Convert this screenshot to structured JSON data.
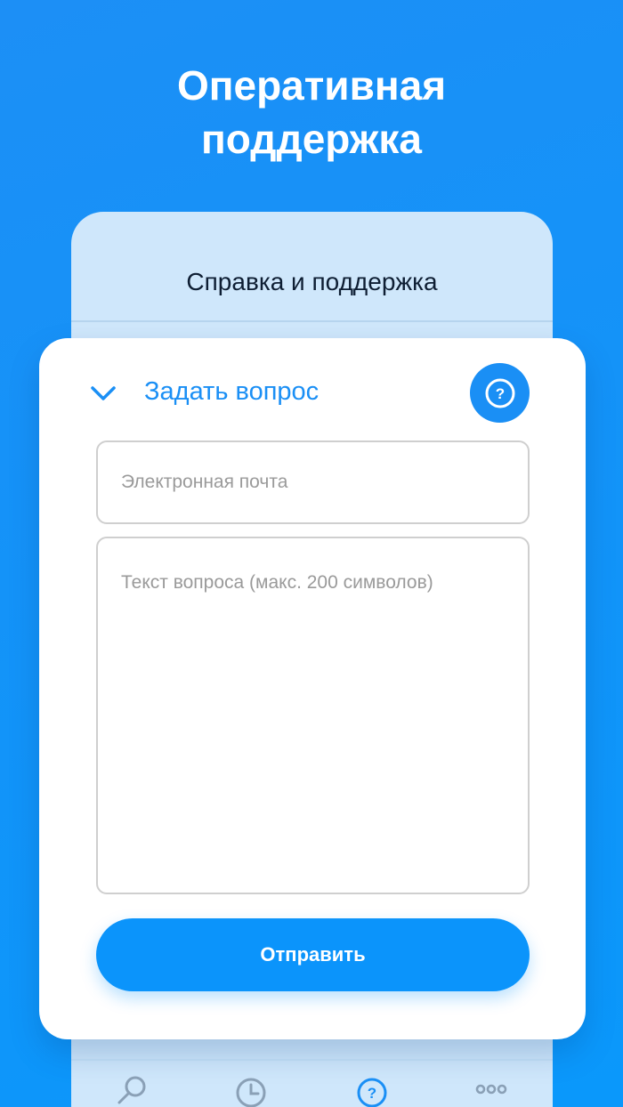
{
  "hero": {
    "line1": "Оперативная",
    "line2": "поддержка"
  },
  "screen": {
    "title": "Справка и поддержка"
  },
  "ask_card": {
    "label": "Задать вопрос",
    "email_placeholder": "Электронная почта",
    "question_placeholder": "Текст вопроса (макс. 200 символов)",
    "submit_label": "Отправить"
  },
  "tabbar": {
    "items": [
      {
        "icon": "search-icon",
        "active": false
      },
      {
        "icon": "history-icon",
        "active": false
      },
      {
        "icon": "help-icon",
        "active": true
      },
      {
        "icon": "more-icon",
        "active": false
      }
    ]
  },
  "colors": {
    "accent": "#1a8ff5",
    "background": "#0a98fb",
    "inactive_icon": "#8aa0b6"
  }
}
